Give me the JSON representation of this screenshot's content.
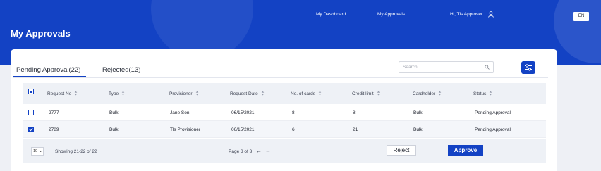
{
  "header": {
    "title": "My Approvals",
    "nav": {
      "dashboard": "My Dashboard",
      "approvals": "My Approvals",
      "greeting": "Hi, Tls Approver"
    },
    "language": "EN"
  },
  "tabs": {
    "pending": "Pending Approval(22)",
    "rejected": "Rejected(13)"
  },
  "search": {
    "placeholder": "Search",
    "value": ""
  },
  "table": {
    "columns": [
      "Request No",
      "Type",
      "Provisioner",
      "Request Date",
      "No. of cards",
      "Credit limit",
      "Cardholder",
      "Status"
    ],
    "rows": [
      {
        "checked": false,
        "request_no": "2777",
        "type": "Bulk",
        "provisioner": "Jane Son",
        "request_date": "06/15/2021",
        "no_of_cards": "8",
        "credit_limit": "8",
        "cardholder": "Bulk",
        "status": "Pending Approval"
      },
      {
        "checked": true,
        "request_no": "2789",
        "type": "Bulk",
        "provisioner": "Tls Provisioner",
        "request_date": "06/15/2021",
        "no_of_cards": "6",
        "credit_limit": "21",
        "cardholder": "Bulk",
        "status": "Pending Approval"
      }
    ]
  },
  "footer": {
    "page_size": "10",
    "showing": "Showing 21-22 of 22",
    "page_info": "Page 3 of 3",
    "reject_label": "Reject",
    "approve_label": "Approve"
  },
  "colors": {
    "brand": "#1342c4",
    "header_bg": "#1342c4",
    "page_bg": "#eef0f5"
  }
}
